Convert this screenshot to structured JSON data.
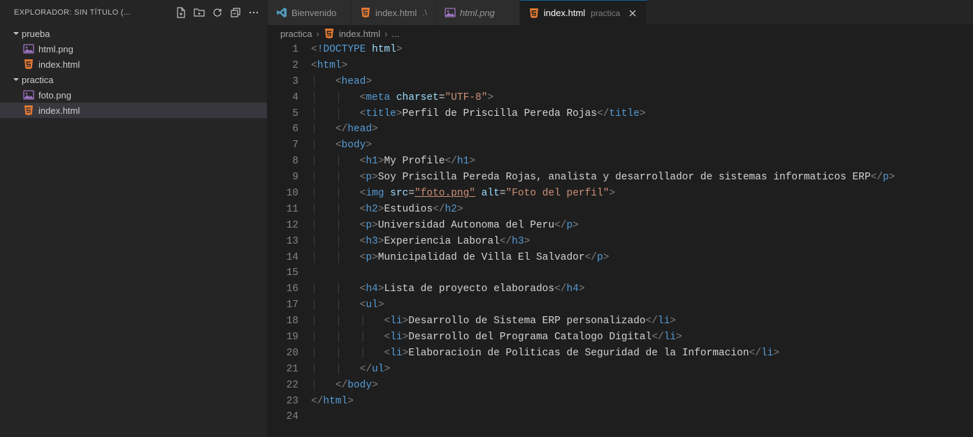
{
  "sidebar": {
    "title": "EXPLORADOR: SIN TÍTULO (...",
    "tree": [
      {
        "label": "prueba",
        "type": "folder",
        "indent": 2
      },
      {
        "label": "html.png",
        "type": "img",
        "indent": 4
      },
      {
        "label": "index.html",
        "type": "html",
        "indent": 4
      },
      {
        "label": "practica",
        "type": "folder",
        "indent": 2
      },
      {
        "label": "foto.png",
        "type": "img",
        "indent": 4
      },
      {
        "label": "index.html",
        "type": "html",
        "indent": 4,
        "selected": true
      }
    ]
  },
  "tabs": [
    {
      "label": "Bienvenido",
      "icon": "vscode",
      "suffix": ""
    },
    {
      "label": "index.html",
      "icon": "html",
      "suffix": ".\\"
    },
    {
      "label": "html.png",
      "icon": "img",
      "suffix": "",
      "italic": true
    },
    {
      "label": "index.html",
      "icon": "html",
      "suffix": "practica",
      "active": true
    }
  ],
  "breadcrumbs": {
    "seg0": "practica",
    "seg1": "index.html",
    "seg2": "..."
  },
  "code": {
    "lines": [
      {
        "n": 1,
        "indent": 0,
        "tokens": [
          [
            "brkt",
            "<"
          ],
          [
            "doctype",
            "!DOCTYPE"
          ],
          [
            "txt",
            " "
          ],
          [
            "attr",
            "html"
          ],
          [
            "brkt",
            ">"
          ]
        ]
      },
      {
        "n": 2,
        "indent": 0,
        "tokens": [
          [
            "brkt",
            "<"
          ],
          [
            "tag",
            "html"
          ],
          [
            "brkt",
            ">"
          ]
        ]
      },
      {
        "n": 3,
        "indent": 1,
        "tokens": [
          [
            "brkt",
            "<"
          ],
          [
            "tag",
            "head"
          ],
          [
            "brkt",
            ">"
          ]
        ]
      },
      {
        "n": 4,
        "indent": 2,
        "tokens": [
          [
            "brkt",
            "<"
          ],
          [
            "tag",
            "meta"
          ],
          [
            "txt",
            " "
          ],
          [
            "attr",
            "charset"
          ],
          [
            "txt",
            "="
          ],
          [
            "str",
            "\"UTF-8\""
          ],
          [
            "brkt",
            ">"
          ]
        ]
      },
      {
        "n": 5,
        "indent": 2,
        "tokens": [
          [
            "brkt",
            "<"
          ],
          [
            "tag",
            "title"
          ],
          [
            "brkt",
            ">"
          ],
          [
            "txt",
            "Perfil de Priscilla Pereda Rojas"
          ],
          [
            "brkt",
            "</"
          ],
          [
            "tag",
            "title"
          ],
          [
            "brkt",
            ">"
          ]
        ]
      },
      {
        "n": 6,
        "indent": 1,
        "tokens": [
          [
            "brkt",
            "</"
          ],
          [
            "tag",
            "head"
          ],
          [
            "brkt",
            ">"
          ]
        ]
      },
      {
        "n": 7,
        "indent": 1,
        "tokens": [
          [
            "brkt",
            "<"
          ],
          [
            "tag",
            "body"
          ],
          [
            "brkt",
            ">"
          ]
        ]
      },
      {
        "n": 8,
        "indent": 2,
        "tokens": [
          [
            "brkt",
            "<"
          ],
          [
            "tag",
            "h1"
          ],
          [
            "brkt",
            ">"
          ],
          [
            "txt",
            "My Profile"
          ],
          [
            "brkt",
            "</"
          ],
          [
            "tag",
            "h1"
          ],
          [
            "brkt",
            ">"
          ]
        ]
      },
      {
        "n": 9,
        "indent": 2,
        "tokens": [
          [
            "brkt",
            "<"
          ],
          [
            "tag",
            "p"
          ],
          [
            "brkt",
            ">"
          ],
          [
            "txt",
            "Soy Priscilla Pereda Rojas, analista y desarrollador de sistemas informaticos ERP"
          ],
          [
            "brkt",
            "</"
          ],
          [
            "tag",
            "p"
          ],
          [
            "brkt",
            ">"
          ]
        ]
      },
      {
        "n": 10,
        "indent": 2,
        "tokens": [
          [
            "brkt",
            "<"
          ],
          [
            "tag",
            "img"
          ],
          [
            "txt",
            " "
          ],
          [
            "attr",
            "src"
          ],
          [
            "txt",
            "="
          ],
          [
            "str-ul",
            "\"foto.png\""
          ],
          [
            "txt",
            " "
          ],
          [
            "attr",
            "alt"
          ],
          [
            "txt",
            "="
          ],
          [
            "str",
            "\"Foto del perfil\""
          ],
          [
            "brkt",
            ">"
          ]
        ]
      },
      {
        "n": 11,
        "indent": 2,
        "tokens": [
          [
            "brkt",
            "<"
          ],
          [
            "tag",
            "h2"
          ],
          [
            "brkt",
            ">"
          ],
          [
            "txt",
            "Estudios"
          ],
          [
            "brkt",
            "</"
          ],
          [
            "tag",
            "h2"
          ],
          [
            "brkt",
            ">"
          ]
        ]
      },
      {
        "n": 12,
        "indent": 2,
        "tokens": [
          [
            "brkt",
            "<"
          ],
          [
            "tag",
            "p"
          ],
          [
            "brkt",
            ">"
          ],
          [
            "txt",
            "Universidad Autonoma del Peru"
          ],
          [
            "brkt",
            "</"
          ],
          [
            "tag",
            "p"
          ],
          [
            "brkt",
            ">"
          ]
        ]
      },
      {
        "n": 13,
        "indent": 2,
        "tokens": [
          [
            "brkt",
            "<"
          ],
          [
            "tag",
            "h3"
          ],
          [
            "brkt",
            ">"
          ],
          [
            "txt",
            "Experiencia Laboral"
          ],
          [
            "brkt",
            "</"
          ],
          [
            "tag",
            "h3"
          ],
          [
            "brkt",
            ">"
          ]
        ]
      },
      {
        "n": 14,
        "indent": 2,
        "tokens": [
          [
            "brkt",
            "<"
          ],
          [
            "tag",
            "p"
          ],
          [
            "brkt",
            ">"
          ],
          [
            "txt",
            "Municipalidad de Villa El Salvador"
          ],
          [
            "brkt",
            "</"
          ],
          [
            "tag",
            "p"
          ],
          [
            "brkt",
            ">"
          ]
        ]
      },
      {
        "n": 15,
        "indent": 0,
        "tokens": []
      },
      {
        "n": 16,
        "indent": 2,
        "tokens": [
          [
            "brkt",
            "<"
          ],
          [
            "tag",
            "h4"
          ],
          [
            "brkt",
            ">"
          ],
          [
            "txt",
            "Lista de proyecto elaborados"
          ],
          [
            "brkt",
            "</"
          ],
          [
            "tag",
            "h4"
          ],
          [
            "brkt",
            ">"
          ]
        ]
      },
      {
        "n": 17,
        "indent": 2,
        "tokens": [
          [
            "brkt",
            "<"
          ],
          [
            "tag",
            "ul"
          ],
          [
            "brkt",
            ">"
          ]
        ]
      },
      {
        "n": 18,
        "indent": 3,
        "tokens": [
          [
            "brkt",
            "<"
          ],
          [
            "tag",
            "li"
          ],
          [
            "brkt",
            ">"
          ],
          [
            "txt",
            "Desarrollo de Sistema ERP personalizado"
          ],
          [
            "brkt",
            "</"
          ],
          [
            "tag",
            "li"
          ],
          [
            "brkt",
            ">"
          ]
        ]
      },
      {
        "n": 19,
        "indent": 3,
        "tokens": [
          [
            "brkt",
            "<"
          ],
          [
            "tag",
            "li"
          ],
          [
            "brkt",
            ">"
          ],
          [
            "txt",
            "Desarrollo del Programa Catalogo Digital"
          ],
          [
            "brkt",
            "</"
          ],
          [
            "tag",
            "li"
          ],
          [
            "brkt",
            ">"
          ]
        ]
      },
      {
        "n": 20,
        "indent": 3,
        "tokens": [
          [
            "brkt",
            "<"
          ],
          [
            "tag",
            "li"
          ],
          [
            "brkt",
            ">"
          ],
          [
            "txt",
            "Elaboracioin de Politicas de Seguridad de la Informacion"
          ],
          [
            "brkt",
            "</"
          ],
          [
            "tag",
            "li"
          ],
          [
            "brkt",
            ">"
          ]
        ]
      },
      {
        "n": 21,
        "indent": 2,
        "tokens": [
          [
            "brkt",
            "</"
          ],
          [
            "tag",
            "ul"
          ],
          [
            "brkt",
            ">"
          ]
        ]
      },
      {
        "n": 22,
        "indent": 1,
        "tokens": [
          [
            "brkt",
            "</"
          ],
          [
            "tag",
            "body"
          ],
          [
            "brkt",
            ">"
          ]
        ]
      },
      {
        "n": 23,
        "indent": 0,
        "tokens": [
          [
            "brkt",
            "</"
          ],
          [
            "tag",
            "html"
          ],
          [
            "brkt",
            ">"
          ]
        ]
      },
      {
        "n": 24,
        "indent": 0,
        "tokens": []
      }
    ]
  }
}
